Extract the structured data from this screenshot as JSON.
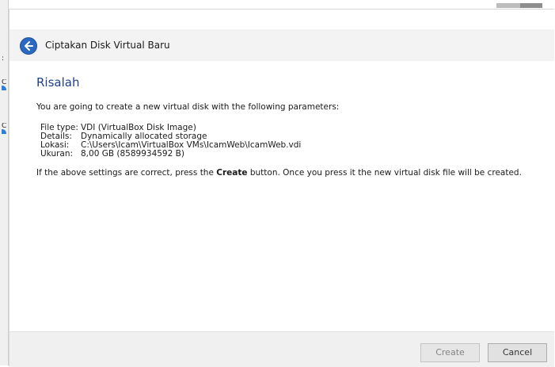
{
  "window": {
    "title": "Ciptakan Disk Virtual Baru"
  },
  "content": {
    "heading": "Risalah",
    "intro": "You are going to create a new virtual disk with the following parameters:",
    "params": [
      {
        "key": "File type:",
        "value": "VDI (VirtualBox Disk Image)"
      },
      {
        "key": "Details:",
        "value": "Dynamically allocated storage"
      },
      {
        "key": "Lokasi:",
        "value": "C:\\Users\\Icam\\VirtualBox VMs\\IcamWeb\\IcamWeb.vdi"
      },
      {
        "key": "Ukuran:",
        "value": "8,00 GB (8589934592 B)"
      }
    ],
    "note_before": "If the above settings are correct, press the ",
    "note_bold": "Create",
    "note_after": " button. Once you press it the new virtual disk file will be created."
  },
  "buttons": {
    "create": "Create",
    "cancel": "Cancel"
  },
  "colors": {
    "heading": "#1e3f8c",
    "back_button": "#2a68c2"
  },
  "icons": {
    "back": "back-arrow-icon"
  }
}
